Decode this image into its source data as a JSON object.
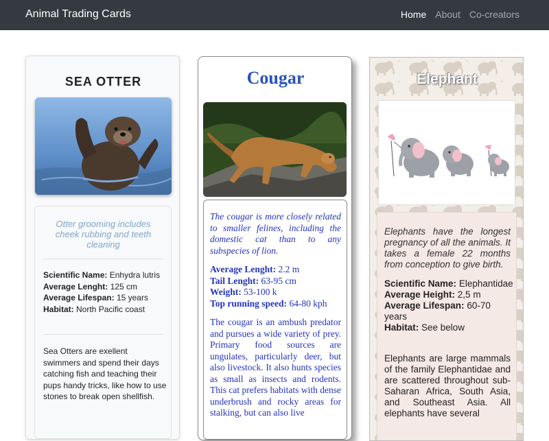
{
  "navbar": {
    "brand": "Animal Trading Cards",
    "links": [
      {
        "label": "Home"
      },
      {
        "label": "About"
      },
      {
        "label": "Co-creators"
      }
    ]
  },
  "cards": {
    "otter": {
      "title": "SEA OTTER",
      "quote": "Otter grooming includes cheek rubbing and teeth cleaning",
      "facts": [
        {
          "label": "Scientific Name:",
          "value": "Enhydra lutris"
        },
        {
          "label": "Average Lenght:",
          "value": "125 cm"
        },
        {
          "label": "Average Lifespan:",
          "value": "15 years"
        },
        {
          "label": "Habitat:",
          "value": "North Pacific coast"
        }
      ],
      "description": "Sea Otters are exellent swimmers and spend their days catching fish and teaching their pups handy tricks, like how to use stones to break open shellfish."
    },
    "cougar": {
      "title": "Cougar",
      "quote": "The cougar is more closely related to smaller felines, including the domestic cat than to any subspecies of lion.",
      "facts": [
        {
          "label": "Average Lenght:",
          "value": "2.2 m"
        },
        {
          "label": "Tail Lenght:",
          "value": "63-95 cm"
        },
        {
          "label": "Weight:",
          "value": "53-100 k"
        },
        {
          "label": "Top running speed:",
          "value": "64-80 kph"
        }
      ],
      "description": "The cougar is an ambush predator and pursues a wide variety of prey. Primary food sources are ungulates, particularly deer, but also livestock. It also hunts species as small as insects and rodents. This cat prefers habitats with dense underbrush and rocky areas for stalking, but can also live"
    },
    "elephant": {
      "title": "Elephant",
      "quote": "Elephants have the longest pregnancy of all the animals. It takes a female 22 months from conception to give birth.",
      "facts": [
        {
          "label": "Scientific Name:",
          "value": "Elephantidae"
        },
        {
          "label": "Average Height:",
          "value": "2,5 m"
        },
        {
          "label": "Average Lifespan:",
          "value": "60-70 years"
        },
        {
          "label": "Habitat:",
          "value": "See below"
        }
      ],
      "description": "Elephants are large mammals of the family Elephantidae and are scattered throughout sub-Saharan Africa, South Asia, and Southeast Asia. All elephants have several"
    }
  }
}
